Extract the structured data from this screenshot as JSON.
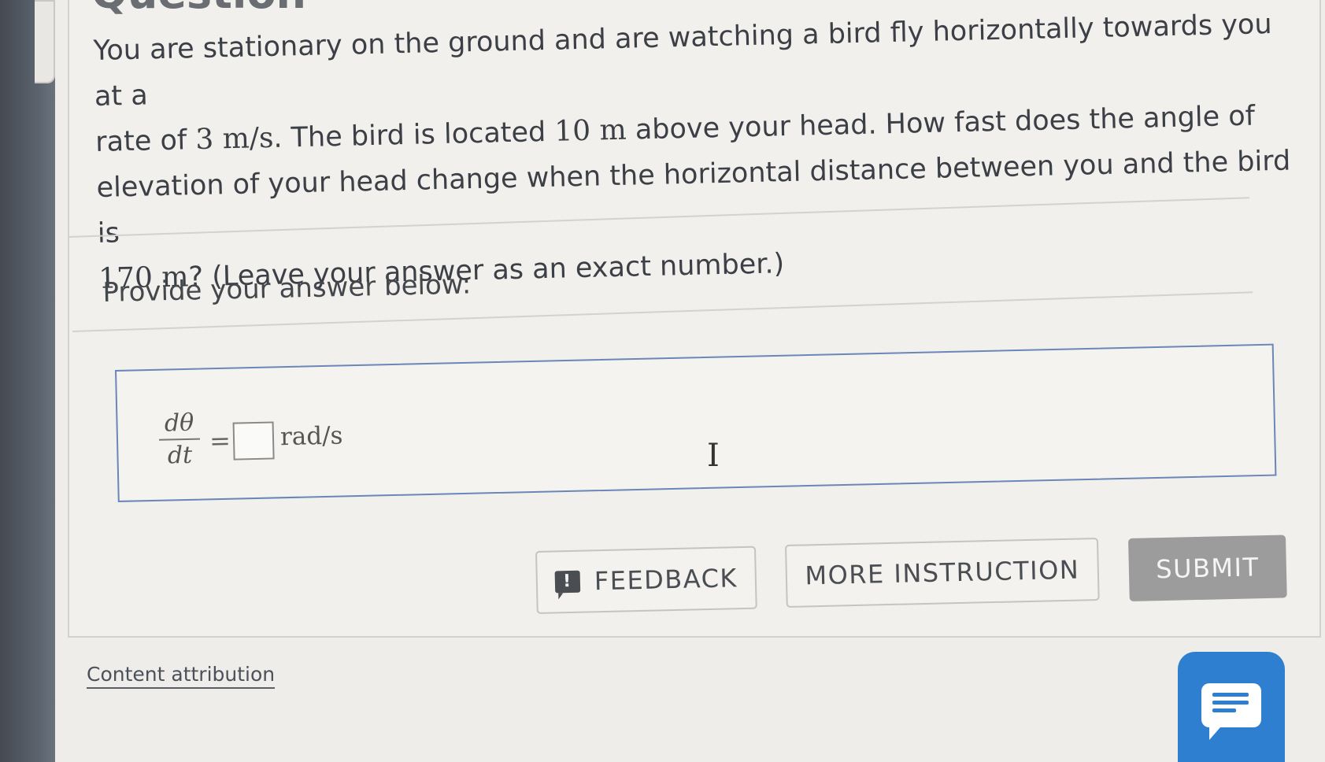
{
  "page": {
    "heading_partial": "Question"
  },
  "question": {
    "line1": "You are stationary on the ground and are watching a bird fly horizontally towards you at a",
    "line2_a": "rate of ",
    "line2_rate": "3 m/s",
    "line2_b": ". The bird is located ",
    "line2_height": "10 m",
    "line2_c": " above your head. How fast does the angle of",
    "line3": "elevation of your head change when the horizontal distance between you and the bird is",
    "line4_distance": "170 m",
    "line4_b": "? (Leave your answer as an exact number.)"
  },
  "answer": {
    "prompt": "Provide your answer below:",
    "frac_num": "dθ",
    "frac_den": "dt",
    "equals": "=",
    "value": "",
    "unit": "rad/s"
  },
  "buttons": {
    "feedback": "FEEDBACK",
    "feedback_icon_glyph": "!",
    "more_instruction": "MORE INSTRUCTION",
    "submit": "SUBMIT"
  },
  "footer": {
    "attribution": "Content attribution"
  },
  "icons": {
    "feedback": "exclamation-speech-icon",
    "chat": "chat-bubble-icon",
    "cursor": "text-cursor-icon"
  },
  "colors": {
    "answer_border": "#6b86b8",
    "submit_bg": "#9c9c9c",
    "chat_bg": "#2f7fd0"
  }
}
